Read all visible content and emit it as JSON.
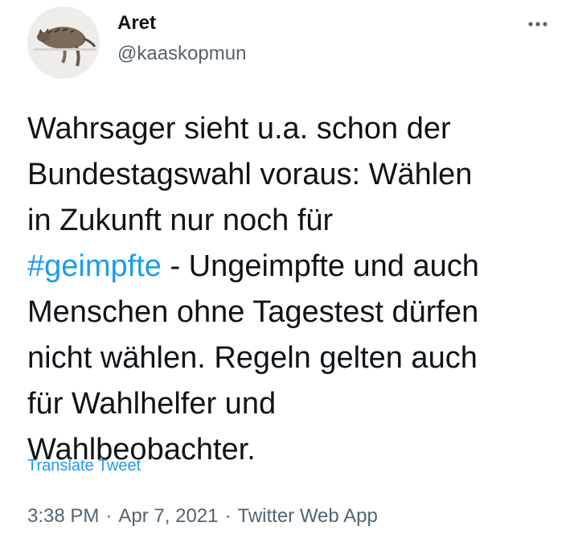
{
  "author": {
    "display_name": "Aret",
    "handle": "@kaaskopmun",
    "avatar_icon": "cat-avatar"
  },
  "menu": {
    "icon": "more-horizontal-icon"
  },
  "tweet": {
    "lines": [
      "Wahrsager sieht u.a. schon der",
      "Bundestagswahl voraus: Wählen",
      "in Zukunft nur noch für"
    ],
    "hashtag": "#geimpfte",
    "hashtag_rest": " - Ungeimpfte und auch",
    "lines_after": [
      "Menschen ohne Tagestest dürfen",
      "nicht wählen. Regeln gelten auch",
      "für Wahlhelfer und",
      "Wahlbeobachter."
    ]
  },
  "translate_label": "Translate Tweet",
  "meta": {
    "time": "3:38 PM",
    "separator": "·",
    "date": "Apr 7, 2021",
    "source": "Twitter Web App"
  },
  "colors": {
    "link": "#1d9bf0",
    "text": "#0f1419",
    "muted": "#536471"
  }
}
